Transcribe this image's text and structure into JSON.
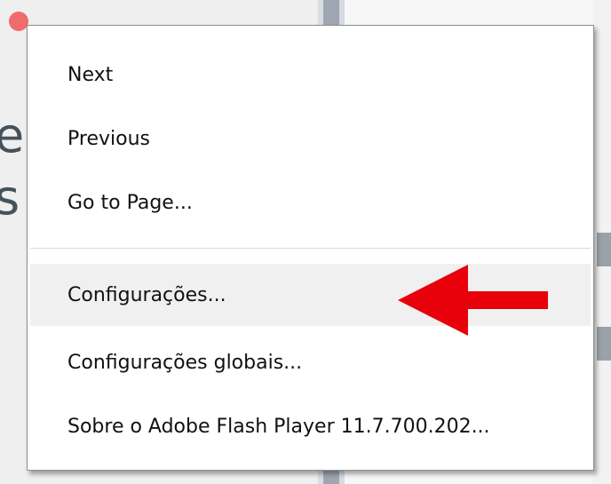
{
  "context_menu": {
    "items": [
      {
        "label": "Next"
      },
      {
        "label": "Previous"
      },
      {
        "label": "Go to Page..."
      },
      {
        "label": "Configurações..."
      },
      {
        "label": "Configurações globais..."
      },
      {
        "label": "Sobre o Adobe Flash Player 11.7.700.202..."
      }
    ],
    "highlighted_item": "Configurações..."
  },
  "background": {
    "partial_glyphs": [
      "e",
      "s"
    ]
  },
  "annotation": {
    "arrow_icon": "red-left-arrow-icon",
    "arrow_color": "#e8000b"
  },
  "colors": {
    "menu_background": "#ffffff",
    "menu_border": "#8e8e8e",
    "hover_background": "#f0f0f0",
    "text": "#111111",
    "accent_dot": "#f06b6b"
  }
}
